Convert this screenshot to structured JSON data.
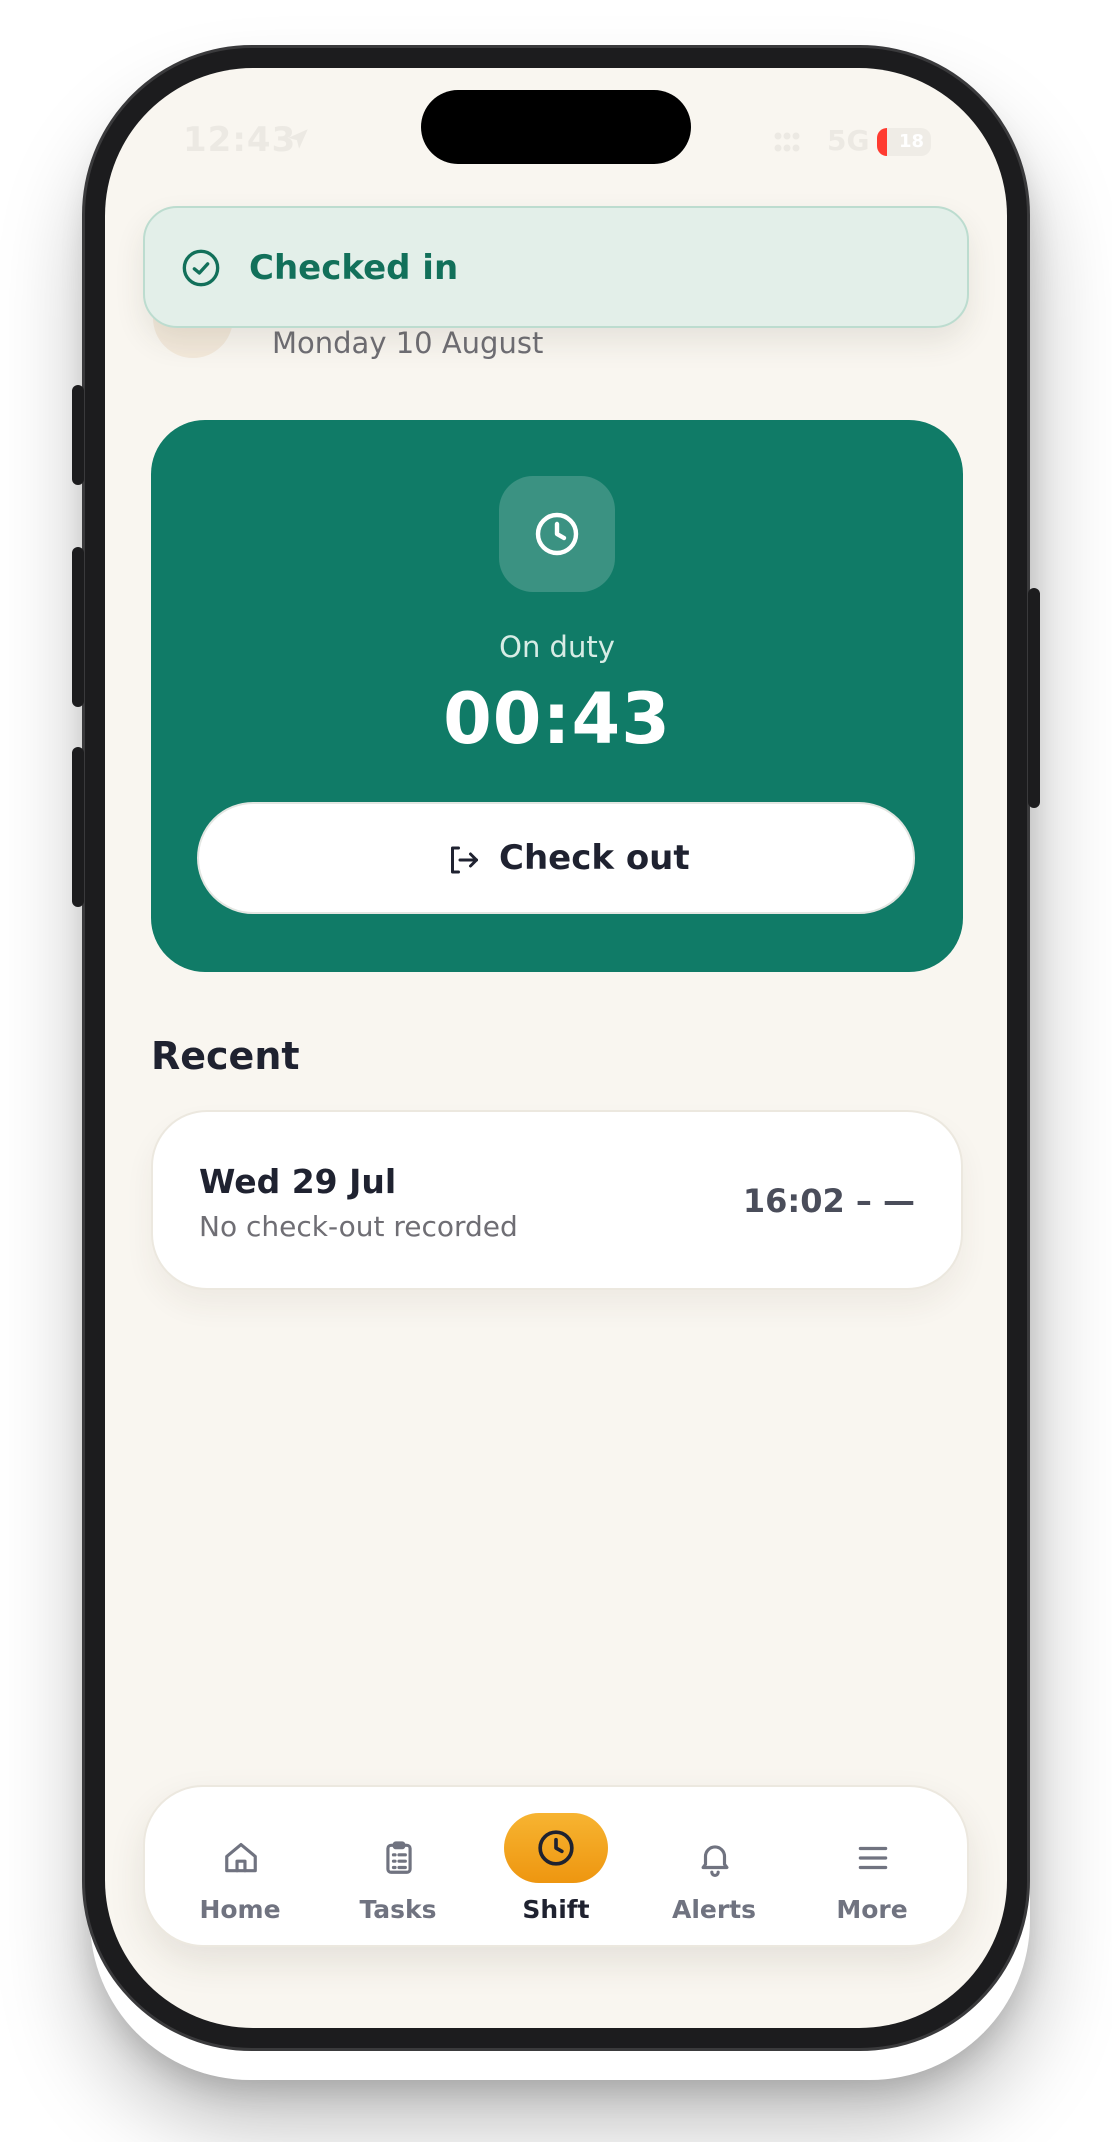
{
  "status_bar": {
    "time": "12:43",
    "network": "5G",
    "battery_percent": "18",
    "battery_level": 0.18,
    "battery_color": "#ff3b30"
  },
  "header": {
    "subtitle": "Monday 10 August"
  },
  "toast": {
    "label": "Checked in",
    "color": "#12705a",
    "icon": "check-circle-icon"
  },
  "shift_card": {
    "accent": "#107b67",
    "icon": "clock-icon",
    "status_label": "On duty",
    "elapsed": "00:43",
    "checkout_label": "Check out",
    "checkout_icon": "log-out-icon"
  },
  "recent": {
    "title": "Recent",
    "items": [
      {
        "date": "Wed 29 Jul",
        "note": "No check-out recorded",
        "range": "16:02 – —"
      }
    ]
  },
  "tabbar": {
    "active_color": "#f2a11b",
    "items": [
      {
        "label": "Home",
        "icon": "home-icon"
      },
      {
        "label": "Tasks",
        "icon": "clipboard-icon"
      },
      {
        "label": "Shift",
        "icon": "clock-icon",
        "active": true
      },
      {
        "label": "Alerts",
        "icon": "bell-icon"
      },
      {
        "label": "More",
        "icon": "menu-icon"
      }
    ]
  }
}
